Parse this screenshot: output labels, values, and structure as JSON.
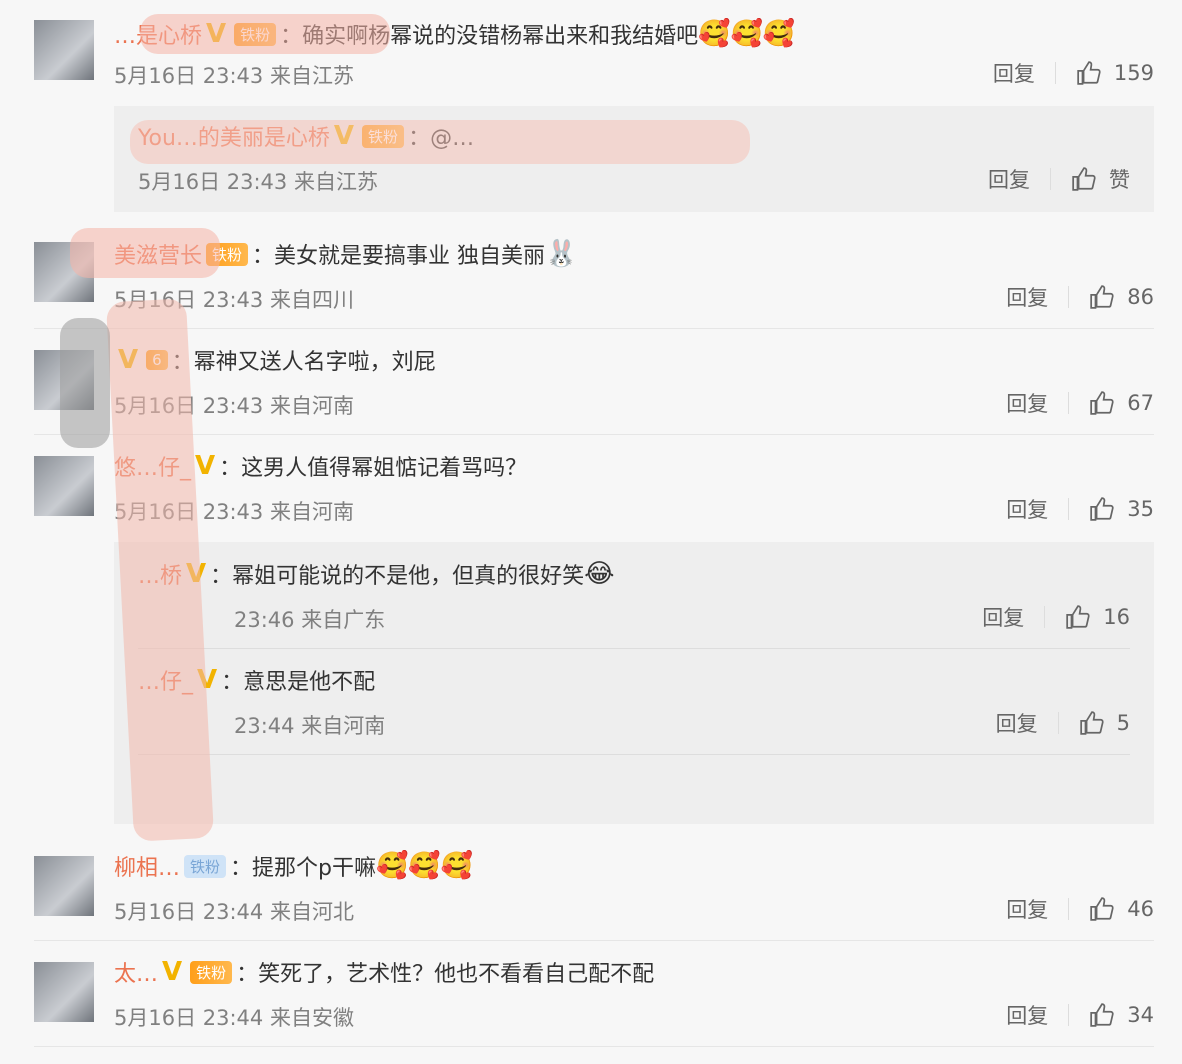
{
  "comments": [
    {
      "name": "…是心桥",
      "fan": "铁粉",
      "text": "：确实啊杨幂说的没错杨幂出来和我结婚吧",
      "emoji": "🥰🥰🥰",
      "meta": "5月16日 23:43 来自江苏",
      "reply": "回复",
      "likes": "159"
    },
    {
      "name": "美滋营长",
      "fan": "铁粉",
      "text": "：美女就是要搞事业 独自美丽",
      "emoji": "🐰",
      "meta": "5月16日 23:43 来自四川",
      "reply": "回复",
      "likes": "86"
    },
    {
      "name": "",
      "fan": "6",
      "text": "：幂神又送人名字啦，刘屁",
      "emoji": "",
      "meta": "5月16日 23:43 来自河南",
      "reply": "回复",
      "likes": "67"
    },
    {
      "name": "悠…仔_",
      "fan": "",
      "text": "：这男人值得幂姐惦记着骂吗？",
      "emoji": "",
      "meta": "5月16日 23:43 来自河南",
      "reply": "回复",
      "likes": "35"
    },
    {
      "name": "柳相…",
      "fan": "铁粉",
      "text": "：提那个p干嘛",
      "emoji": "🥰🥰🥰",
      "meta": "5月16日 23:44 来自河北",
      "reply": "回复",
      "likes": "46"
    },
    {
      "name": "太…",
      "fan": "铁粉",
      "text": "：笑死了，艺术性？他也不看看自己配不配",
      "emoji": "",
      "meta": "5月16日 23:44 来自安徽",
      "reply": "回复",
      "likes": "34"
    }
  ],
  "sub1": {
    "name": "You…的美丽是心桥",
    "fan": "铁粉",
    "text": "：@…",
    "meta": "5月16日 23:43 来自江苏",
    "reply": "回复",
    "likes": "赞"
  },
  "sub2": [
    {
      "name": "…桥",
      "text": "：幂姐可能说的不是他，但真的很好笑",
      "emoji": "😂",
      "meta": "23:46 来自广东",
      "reply": "回复",
      "likes": "16"
    },
    {
      "name": "…仔_",
      "text": "：意思是他不配",
      "emoji": "",
      "meta": "23:44 来自河南",
      "reply": "回复",
      "likes": "5"
    }
  ]
}
